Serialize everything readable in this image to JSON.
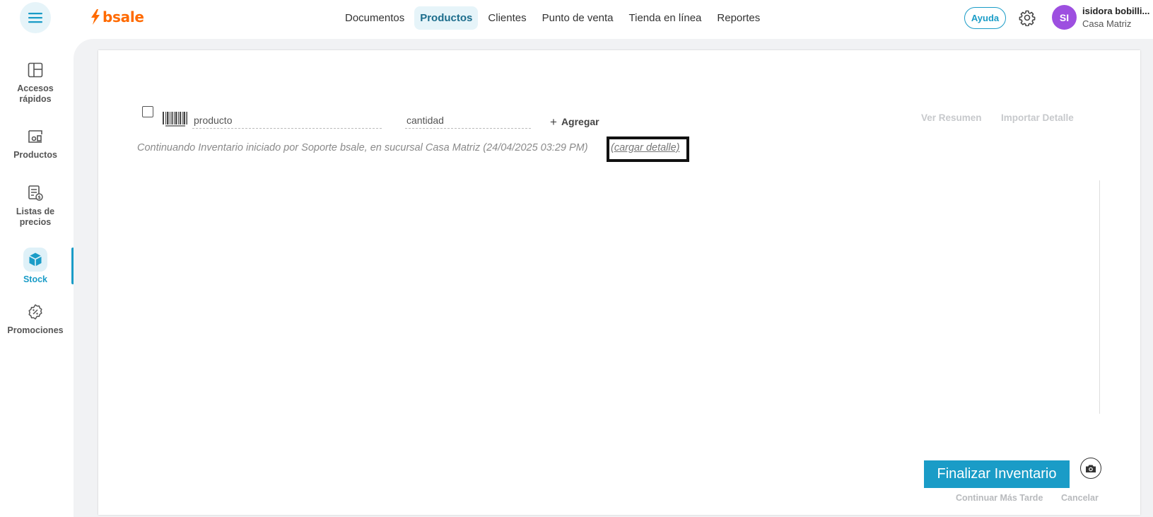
{
  "header": {
    "logo_text": "bsale",
    "nav": [
      {
        "label": "Documentos",
        "active": false
      },
      {
        "label": "Productos",
        "active": true
      },
      {
        "label": "Clientes",
        "active": false
      },
      {
        "label": "Punto de venta",
        "active": false
      },
      {
        "label": "Tienda en línea",
        "active": false
      },
      {
        "label": "Reportes",
        "active": false
      }
    ],
    "help_label": "Ayuda",
    "settings_icon": "gear-icon",
    "user": {
      "initials": "SI",
      "name": "isidora bobilli...",
      "branch": "Casa Matriz",
      "avatar_color": "#9d4fe0"
    }
  },
  "sidebar": {
    "items": [
      {
        "label": "Accesos rápidos",
        "icon": "layout-icon",
        "active": false
      },
      {
        "label": "Productos",
        "icon": "products-icon",
        "active": false
      },
      {
        "label": "Listas de precios",
        "icon": "price-list-icon",
        "active": false
      },
      {
        "label": "Stock",
        "icon": "cube-icon",
        "active": true
      },
      {
        "label": "Promociones",
        "icon": "promo-badge-icon",
        "active": false
      }
    ]
  },
  "inventory": {
    "product_placeholder": "producto",
    "quantity_placeholder": "cantidad",
    "add_label": "Agregar",
    "view_summary_label": "Ver Resumen",
    "import_detail_label": "Importar Detalle",
    "info_text": "Continuando Inventario iniciado por Soporte bsale, en sucursal Casa Matriz (24/04/2025 03:29 PM)",
    "load_detail_label": "(cargar detalle)",
    "finish_label": "Finalizar Inventario",
    "continue_later_label": "Continuar Más Tarde",
    "cancel_label": "Cancelar"
  },
  "colors": {
    "accent": "#1a9cc7",
    "brand": "#ff6a00",
    "active_bg": "#e6f4f9"
  }
}
